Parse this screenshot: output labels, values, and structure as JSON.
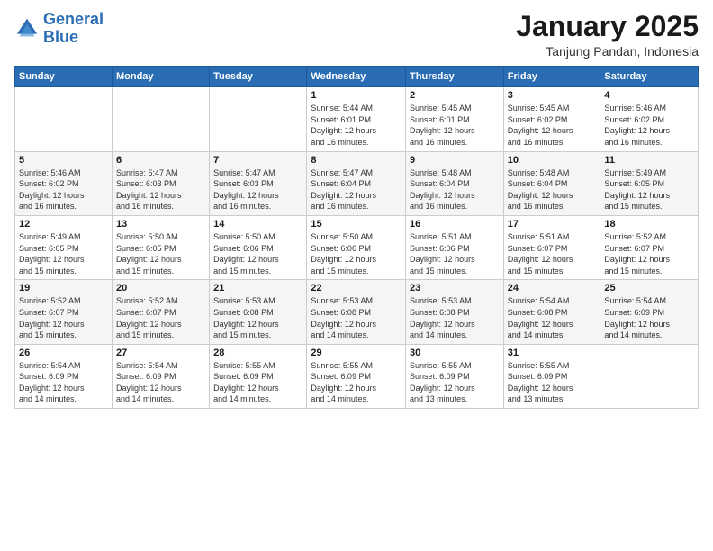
{
  "logo": {
    "line1": "General",
    "line2": "Blue"
  },
  "header": {
    "title": "January 2025",
    "subtitle": "Tanjung Pandan, Indonesia"
  },
  "weekdays": [
    "Sunday",
    "Monday",
    "Tuesday",
    "Wednesday",
    "Thursday",
    "Friday",
    "Saturday"
  ],
  "weeks": [
    [
      {
        "day": "",
        "info": ""
      },
      {
        "day": "",
        "info": ""
      },
      {
        "day": "",
        "info": ""
      },
      {
        "day": "1",
        "info": "Sunrise: 5:44 AM\nSunset: 6:01 PM\nDaylight: 12 hours\nand 16 minutes."
      },
      {
        "day": "2",
        "info": "Sunrise: 5:45 AM\nSunset: 6:01 PM\nDaylight: 12 hours\nand 16 minutes."
      },
      {
        "day": "3",
        "info": "Sunrise: 5:45 AM\nSunset: 6:02 PM\nDaylight: 12 hours\nand 16 minutes."
      },
      {
        "day": "4",
        "info": "Sunrise: 5:46 AM\nSunset: 6:02 PM\nDaylight: 12 hours\nand 16 minutes."
      }
    ],
    [
      {
        "day": "5",
        "info": "Sunrise: 5:46 AM\nSunset: 6:02 PM\nDaylight: 12 hours\nand 16 minutes."
      },
      {
        "day": "6",
        "info": "Sunrise: 5:47 AM\nSunset: 6:03 PM\nDaylight: 12 hours\nand 16 minutes."
      },
      {
        "day": "7",
        "info": "Sunrise: 5:47 AM\nSunset: 6:03 PM\nDaylight: 12 hours\nand 16 minutes."
      },
      {
        "day": "8",
        "info": "Sunrise: 5:47 AM\nSunset: 6:04 PM\nDaylight: 12 hours\nand 16 minutes."
      },
      {
        "day": "9",
        "info": "Sunrise: 5:48 AM\nSunset: 6:04 PM\nDaylight: 12 hours\nand 16 minutes."
      },
      {
        "day": "10",
        "info": "Sunrise: 5:48 AM\nSunset: 6:04 PM\nDaylight: 12 hours\nand 16 minutes."
      },
      {
        "day": "11",
        "info": "Sunrise: 5:49 AM\nSunset: 6:05 PM\nDaylight: 12 hours\nand 15 minutes."
      }
    ],
    [
      {
        "day": "12",
        "info": "Sunrise: 5:49 AM\nSunset: 6:05 PM\nDaylight: 12 hours\nand 15 minutes."
      },
      {
        "day": "13",
        "info": "Sunrise: 5:50 AM\nSunset: 6:05 PM\nDaylight: 12 hours\nand 15 minutes."
      },
      {
        "day": "14",
        "info": "Sunrise: 5:50 AM\nSunset: 6:06 PM\nDaylight: 12 hours\nand 15 minutes."
      },
      {
        "day": "15",
        "info": "Sunrise: 5:50 AM\nSunset: 6:06 PM\nDaylight: 12 hours\nand 15 minutes."
      },
      {
        "day": "16",
        "info": "Sunrise: 5:51 AM\nSunset: 6:06 PM\nDaylight: 12 hours\nand 15 minutes."
      },
      {
        "day": "17",
        "info": "Sunrise: 5:51 AM\nSunset: 6:07 PM\nDaylight: 12 hours\nand 15 minutes."
      },
      {
        "day": "18",
        "info": "Sunrise: 5:52 AM\nSunset: 6:07 PM\nDaylight: 12 hours\nand 15 minutes."
      }
    ],
    [
      {
        "day": "19",
        "info": "Sunrise: 5:52 AM\nSunset: 6:07 PM\nDaylight: 12 hours\nand 15 minutes."
      },
      {
        "day": "20",
        "info": "Sunrise: 5:52 AM\nSunset: 6:07 PM\nDaylight: 12 hours\nand 15 minutes."
      },
      {
        "day": "21",
        "info": "Sunrise: 5:53 AM\nSunset: 6:08 PM\nDaylight: 12 hours\nand 15 minutes."
      },
      {
        "day": "22",
        "info": "Sunrise: 5:53 AM\nSunset: 6:08 PM\nDaylight: 12 hours\nand 14 minutes."
      },
      {
        "day": "23",
        "info": "Sunrise: 5:53 AM\nSunset: 6:08 PM\nDaylight: 12 hours\nand 14 minutes."
      },
      {
        "day": "24",
        "info": "Sunrise: 5:54 AM\nSunset: 6:08 PM\nDaylight: 12 hours\nand 14 minutes."
      },
      {
        "day": "25",
        "info": "Sunrise: 5:54 AM\nSunset: 6:09 PM\nDaylight: 12 hours\nand 14 minutes."
      }
    ],
    [
      {
        "day": "26",
        "info": "Sunrise: 5:54 AM\nSunset: 6:09 PM\nDaylight: 12 hours\nand 14 minutes."
      },
      {
        "day": "27",
        "info": "Sunrise: 5:54 AM\nSunset: 6:09 PM\nDaylight: 12 hours\nand 14 minutes."
      },
      {
        "day": "28",
        "info": "Sunrise: 5:55 AM\nSunset: 6:09 PM\nDaylight: 12 hours\nand 14 minutes."
      },
      {
        "day": "29",
        "info": "Sunrise: 5:55 AM\nSunset: 6:09 PM\nDaylight: 12 hours\nand 14 minutes."
      },
      {
        "day": "30",
        "info": "Sunrise: 5:55 AM\nSunset: 6:09 PM\nDaylight: 12 hours\nand 13 minutes."
      },
      {
        "day": "31",
        "info": "Sunrise: 5:55 AM\nSunset: 6:09 PM\nDaylight: 12 hours\nand 13 minutes."
      },
      {
        "day": "",
        "info": ""
      }
    ]
  ]
}
